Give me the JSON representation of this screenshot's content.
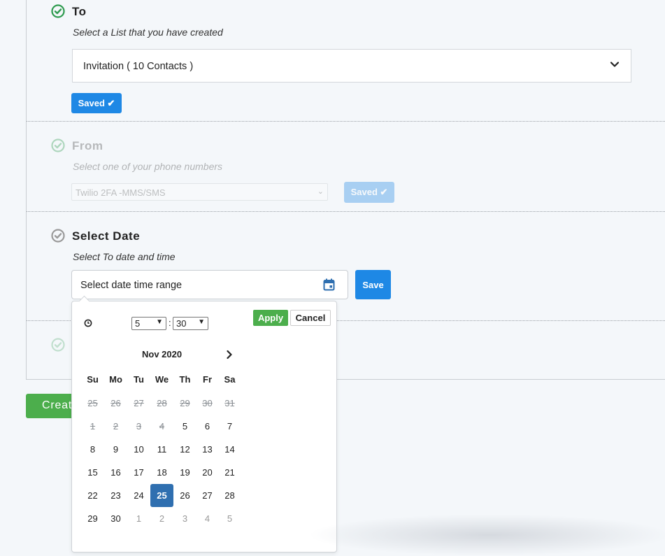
{
  "to": {
    "title": "To",
    "subtitle": "Select a List that you have created",
    "list_value": "Invitation ( 10 Contacts )",
    "saved_label": "Saved ✔"
  },
  "from": {
    "title": "From",
    "subtitle": "Select one of your phone numbers",
    "number_value": "Twilio 2FA -MMS/SMS",
    "saved_label": "Saved ✔"
  },
  "select_date": {
    "title": "Select Date",
    "subtitle": "Select To date and time",
    "input_value": "Select date time range",
    "save_label": "Save"
  },
  "create_button_label": "Create",
  "picker": {
    "hour": "5",
    "minute": "30",
    "time_separator": ":",
    "apply_label": "Apply",
    "cancel_label": "Cancel",
    "month_label": "Nov 2020",
    "weekdays": [
      "Su",
      "Mo",
      "Tu",
      "We",
      "Th",
      "Fr",
      "Sa"
    ],
    "weeks": [
      [
        {
          "d": "25",
          "s": "off"
        },
        {
          "d": "26",
          "s": "off"
        },
        {
          "d": "27",
          "s": "off"
        },
        {
          "d": "28",
          "s": "off"
        },
        {
          "d": "29",
          "s": "off"
        },
        {
          "d": "30",
          "s": "off"
        },
        {
          "d": "31",
          "s": "off"
        }
      ],
      [
        {
          "d": "1",
          "s": "off"
        },
        {
          "d": "2",
          "s": "off"
        },
        {
          "d": "3",
          "s": "off"
        },
        {
          "d": "4",
          "s": "off"
        },
        {
          "d": "5",
          "s": ""
        },
        {
          "d": "6",
          "s": ""
        },
        {
          "d": "7",
          "s": ""
        }
      ],
      [
        {
          "d": "8",
          "s": ""
        },
        {
          "d": "9",
          "s": ""
        },
        {
          "d": "10",
          "s": ""
        },
        {
          "d": "11",
          "s": ""
        },
        {
          "d": "12",
          "s": ""
        },
        {
          "d": "13",
          "s": ""
        },
        {
          "d": "14",
          "s": ""
        }
      ],
      [
        {
          "d": "15",
          "s": ""
        },
        {
          "d": "16",
          "s": ""
        },
        {
          "d": "17",
          "s": ""
        },
        {
          "d": "18",
          "s": ""
        },
        {
          "d": "19",
          "s": ""
        },
        {
          "d": "20",
          "s": ""
        },
        {
          "d": "21",
          "s": ""
        }
      ],
      [
        {
          "d": "22",
          "s": ""
        },
        {
          "d": "23",
          "s": ""
        },
        {
          "d": "24",
          "s": ""
        },
        {
          "d": "25",
          "s": "sel"
        },
        {
          "d": "26",
          "s": ""
        },
        {
          "d": "27",
          "s": ""
        },
        {
          "d": "28",
          "s": ""
        }
      ],
      [
        {
          "d": "29",
          "s": ""
        },
        {
          "d": "30",
          "s": ""
        },
        {
          "d": "1",
          "s": "next"
        },
        {
          "d": "2",
          "s": "next"
        },
        {
          "d": "3",
          "s": "next"
        },
        {
          "d": "4",
          "s": "next"
        },
        {
          "d": "5",
          "s": "next"
        }
      ]
    ]
  },
  "colors": {
    "accent_blue": "#1e88e5",
    "success_green": "#4cae4c",
    "selected_day": "#2f6fb0",
    "step_done_green": "#2e9b4f",
    "step_pending_gray": "#9a9a9a"
  }
}
